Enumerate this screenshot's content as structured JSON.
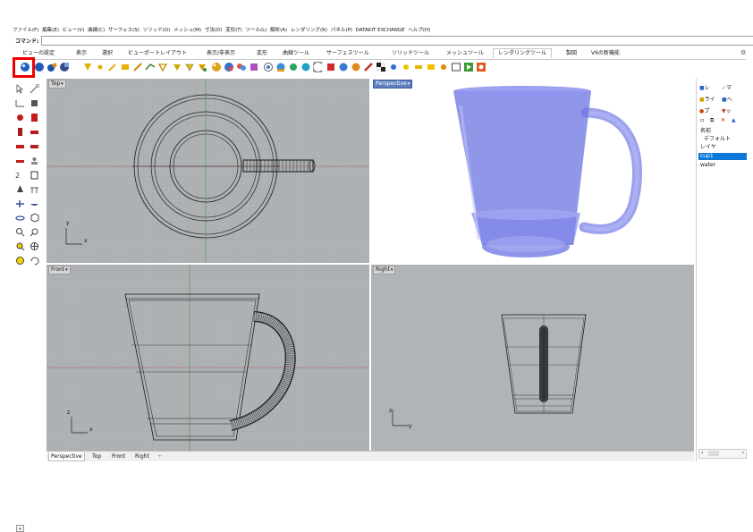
{
  "menubar": {
    "items": [
      "ファイル(F)",
      "編集(E)",
      "ビュー(V)",
      "曲線(C)",
      "サーフェス(S)",
      "ソリッド(O)",
      "メッシュ(M)",
      "寸法(D)",
      "変形(T)",
      "ツール(L)",
      "解析(A)",
      "レンダリング(R)",
      "パネル(P)",
      "DATAKIT EXCHANGE",
      "ヘルプ(H)"
    ]
  },
  "command": {
    "label": "コマンド:",
    "value": "",
    "trailing": ":"
  },
  "tabs": {
    "items": [
      "ビューの設定",
      "表示",
      "選択",
      "ビューポートレイアウト",
      "表示/非表示",
      "変形",
      "曲線ツール",
      "サーフェスツール",
      "ソリッドツール",
      "メッシュツール",
      "レンダリングツール",
      "製図",
      "V6の新機能"
    ],
    "active_index": 10
  },
  "viewports": {
    "top": {
      "label": "Top"
    },
    "perspective": {
      "label": "Perspective"
    },
    "front": {
      "label": "Front"
    },
    "right": {
      "label": "Right"
    },
    "axis_x": "x",
    "axis_y": "y",
    "axis_z": "z"
  },
  "bottom_tabs": {
    "items": [
      "Perspective",
      "Top",
      "Front",
      "Right"
    ],
    "add": "+"
  },
  "right_panel": {
    "tabs": [
      "レ",
      "マ",
      "ライ",
      "ヘ",
      "プ",
      "ッ"
    ],
    "header": "名前",
    "rows": [
      "デフォルト",
      "レイヤ",
      "cup1",
      "water"
    ],
    "selected_index": 2
  },
  "colors": {
    "viewport_bg": "#aeb2b5",
    "grid_minor": "#9da1a4",
    "grid_major": "#8e9295",
    "x_axis": "#b85a5a",
    "y_axis": "#4f9a4f",
    "cup_fill": "#6c74e0",
    "selection_blue": "#0b78d7",
    "highlight_red": "#e00000"
  }
}
